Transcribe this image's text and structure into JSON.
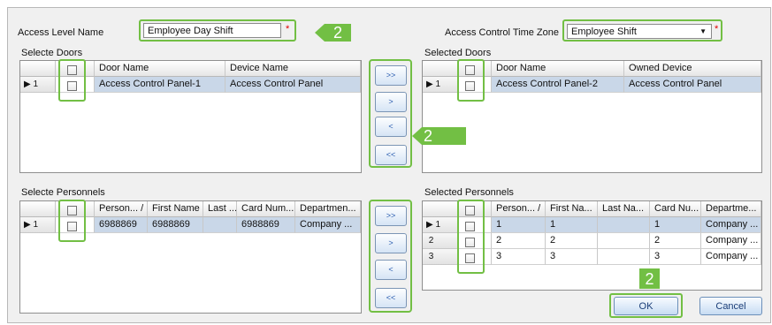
{
  "colors": {
    "highlight": "#72bf44",
    "selected_row": "#c9d7e8",
    "required": "#e00000",
    "button_text": "#2a5db0"
  },
  "header": {
    "access_level_label": "Access Level Name",
    "access_level_value": "Employee Day Shift",
    "tz_label": "Access Control Time Zone",
    "tz_value": "Employee Shift",
    "required_mark": "*"
  },
  "doors_left": {
    "title": "Selecte Doors",
    "col1": "Door Name",
    "col2": "Device Name",
    "rows": [
      {
        "num": "1",
        "name": "Access Control Panel-1",
        "device": "Access Control Panel"
      }
    ]
  },
  "doors_right": {
    "title": "Selected Doors",
    "col1": "Door Name",
    "col2": "Owned Device",
    "rows": [
      {
        "num": "1",
        "name": "Access Control Panel-2",
        "device": "Access Control Panel"
      }
    ]
  },
  "door_buttons": [
    "&gt;&gt;",
    "&gt;",
    "&lt;",
    "&lt;&lt;"
  ],
  "door_buttons_text": [
    ">>",
    ">",
    "<",
    "<<"
  ],
  "pers_left": {
    "title": "Selecte Personnels",
    "cols": [
      "Person... /",
      "First Name",
      "Last ...",
      "Card Num...",
      "Departmen..."
    ],
    "rows": [
      {
        "num": "1",
        "cells": [
          "6988869",
          "6988869",
          "",
          "6988869",
          "Company ..."
        ]
      }
    ]
  },
  "pers_right": {
    "title": "Selected Personnels",
    "cols": [
      "Person... /",
      "First Na...",
      "Last Na...",
      "Card Nu...",
      "Departme..."
    ],
    "rows": [
      {
        "num": "1",
        "cells": [
          "1",
          "1",
          "",
          "1",
          "Company ..."
        ]
      },
      {
        "num": "2",
        "cells": [
          "2",
          "2",
          "",
          "2",
          "Company ..."
        ]
      },
      {
        "num": "3",
        "cells": [
          "3",
          "3",
          "",
          "3",
          "Company ..."
        ]
      }
    ]
  },
  "footer": {
    "ok": "OK",
    "cancel": "Cancel"
  },
  "badges": {
    "b1": "2",
    "b2": "2",
    "b3": "2"
  }
}
